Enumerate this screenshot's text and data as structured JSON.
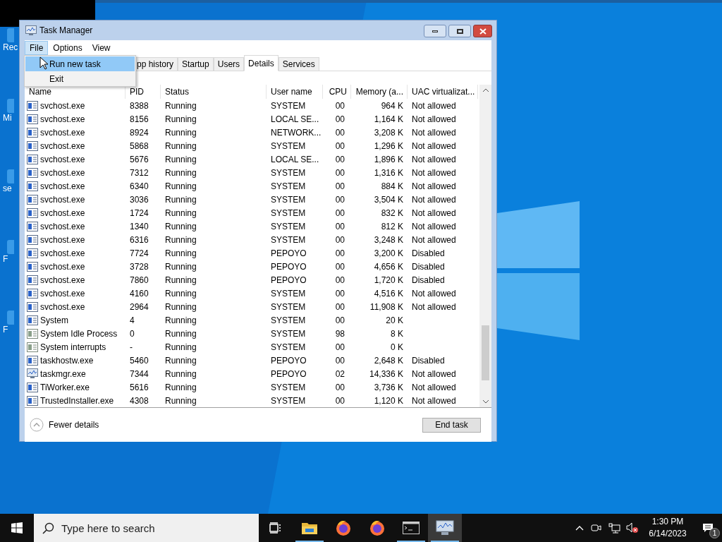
{
  "desktop_icons": [
    {
      "label": "Rec"
    },
    {
      "label": "Mi"
    },
    {
      "label": "se"
    },
    {
      "label": "F"
    },
    {
      "label": "F"
    }
  ],
  "window": {
    "title": "Task Manager"
  },
  "menu_bar": [
    {
      "label": "File",
      "selected": true
    },
    {
      "label": "Options",
      "selected": false
    },
    {
      "label": "View",
      "selected": false
    }
  ],
  "file_menu": [
    {
      "label": "Run new task",
      "selected": true
    },
    {
      "label": "Exit",
      "selected": false
    }
  ],
  "tabs": [
    {
      "label": "pp history",
      "selected": false
    },
    {
      "label": "Startup",
      "selected": false
    },
    {
      "label": "Users",
      "selected": false
    },
    {
      "label": "Details",
      "selected": true
    },
    {
      "label": "Services",
      "selected": false
    }
  ],
  "table": {
    "columns": [
      "Name",
      "PID",
      "Status",
      "User name",
      "CPU",
      "Memory (a...",
      "UAC virtualizat..."
    ],
    "rows": [
      {
        "kind": "app",
        "name": "svchost.exe",
        "pid": "8388",
        "status": "Running",
        "user": "SYSTEM",
        "cpu": "00",
        "memory": "964 K",
        "uac": "Not allowed"
      },
      {
        "kind": "app",
        "name": "svchost.exe",
        "pid": "8156",
        "status": "Running",
        "user": "LOCAL SE...",
        "cpu": "00",
        "memory": "1,164 K",
        "uac": "Not allowed"
      },
      {
        "kind": "app",
        "name": "svchost.exe",
        "pid": "8924",
        "status": "Running",
        "user": "NETWORK...",
        "cpu": "00",
        "memory": "3,208 K",
        "uac": "Not allowed"
      },
      {
        "kind": "app",
        "name": "svchost.exe",
        "pid": "5868",
        "status": "Running",
        "user": "SYSTEM",
        "cpu": "00",
        "memory": "1,296 K",
        "uac": "Not allowed"
      },
      {
        "kind": "app",
        "name": "svchost.exe",
        "pid": "5676",
        "status": "Running",
        "user": "LOCAL SE...",
        "cpu": "00",
        "memory": "1,896 K",
        "uac": "Not allowed"
      },
      {
        "kind": "app",
        "name": "svchost.exe",
        "pid": "7312",
        "status": "Running",
        "user": "SYSTEM",
        "cpu": "00",
        "memory": "1,316 K",
        "uac": "Not allowed"
      },
      {
        "kind": "app",
        "name": "svchost.exe",
        "pid": "6340",
        "status": "Running",
        "user": "SYSTEM",
        "cpu": "00",
        "memory": "884 K",
        "uac": "Not allowed"
      },
      {
        "kind": "app",
        "name": "svchost.exe",
        "pid": "3036",
        "status": "Running",
        "user": "SYSTEM",
        "cpu": "00",
        "memory": "3,504 K",
        "uac": "Not allowed"
      },
      {
        "kind": "app",
        "name": "svchost.exe",
        "pid": "1724",
        "status": "Running",
        "user": "SYSTEM",
        "cpu": "00",
        "memory": "832 K",
        "uac": "Not allowed"
      },
      {
        "kind": "app",
        "name": "svchost.exe",
        "pid": "1340",
        "status": "Running",
        "user": "SYSTEM",
        "cpu": "00",
        "memory": "812 K",
        "uac": "Not allowed"
      },
      {
        "kind": "app",
        "name": "svchost.exe",
        "pid": "6316",
        "status": "Running",
        "user": "SYSTEM",
        "cpu": "00",
        "memory": "3,248 K",
        "uac": "Not allowed"
      },
      {
        "kind": "app",
        "name": "svchost.exe",
        "pid": "7724",
        "status": "Running",
        "user": "PEPOYO",
        "cpu": "00",
        "memory": "3,200 K",
        "uac": "Disabled"
      },
      {
        "kind": "app",
        "name": "svchost.exe",
        "pid": "3728",
        "status": "Running",
        "user": "PEPOYO",
        "cpu": "00",
        "memory": "4,656 K",
        "uac": "Disabled"
      },
      {
        "kind": "app",
        "name": "svchost.exe",
        "pid": "7860",
        "status": "Running",
        "user": "PEPOYO",
        "cpu": "00",
        "memory": "1,720 K",
        "uac": "Disabled"
      },
      {
        "kind": "app",
        "name": "svchost.exe",
        "pid": "4160",
        "status": "Running",
        "user": "SYSTEM",
        "cpu": "00",
        "memory": "4,516 K",
        "uac": "Not allowed"
      },
      {
        "kind": "app",
        "name": "svchost.exe",
        "pid": "2964",
        "status": "Running",
        "user": "SYSTEM",
        "cpu": "00",
        "memory": "11,908 K",
        "uac": "Not allowed"
      },
      {
        "kind": "app",
        "name": "System",
        "pid": "4",
        "status": "Running",
        "user": "SYSTEM",
        "cpu": "00",
        "memory": "20 K"
      },
      {
        "kind": "system",
        "name": "System Idle Process",
        "pid": "0",
        "status": "Running",
        "user": "SYSTEM",
        "cpu": "98",
        "memory": "8 K"
      },
      {
        "kind": "system",
        "name": "System interrupts",
        "pid": "-",
        "status": "Running",
        "user": "SYSTEM",
        "cpu": "00",
        "memory": "0 K"
      },
      {
        "kind": "app",
        "name": "taskhostw.exe",
        "pid": "5460",
        "status": "Running",
        "user": "PEPOYO",
        "cpu": "00",
        "memory": "2,648 K",
        "uac": "Disabled"
      },
      {
        "kind": "monitor",
        "name": "taskmgr.exe",
        "pid": "7344",
        "status": "Running",
        "user": "PEPOYO",
        "cpu": "02",
        "memory": "14,336 K",
        "uac": "Not allowed"
      },
      {
        "kind": "app",
        "name": "TiWorker.exe",
        "pid": "5616",
        "status": "Running",
        "user": "SYSTEM",
        "cpu": "00",
        "memory": "3,736 K",
        "uac": "Not allowed"
      },
      {
        "kind": "app",
        "name": "TrustedInstaller.exe",
        "pid": "4308",
        "status": "Running",
        "user": "SYSTEM",
        "cpu": "00",
        "memory": "1,120 K",
        "uac": "Not allowed"
      }
    ]
  },
  "footer": {
    "toggle": "Fewer details",
    "button": "End task"
  },
  "taskbar": {
    "search": {
      "placeholder": "Type here to search"
    },
    "apps": [
      {
        "kind": "taskview",
        "running": false,
        "active": false
      },
      {
        "kind": "explorer",
        "running": true,
        "active": false
      },
      {
        "kind": "firefox",
        "running": false,
        "active": false
      },
      {
        "kind": "firefox",
        "running": false,
        "active": false
      },
      {
        "kind": "terminal",
        "running": true,
        "active": false
      },
      {
        "kind": "taskmgr",
        "running": true,
        "active": true
      }
    ],
    "time": "1:30 PM",
    "date": "6/14/2023",
    "notifications": "1"
  }
}
